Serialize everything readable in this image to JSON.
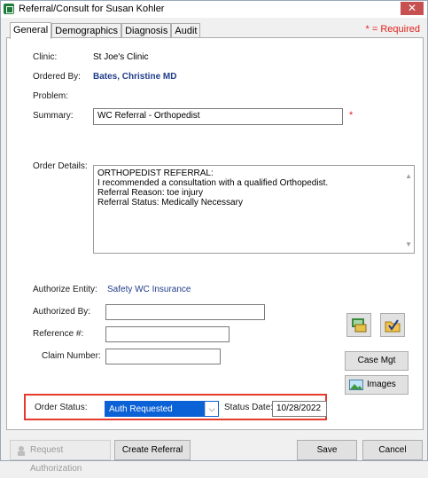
{
  "window": {
    "title": "Referral/Consult for Susan Kohler",
    "close_glyph": "✕"
  },
  "tabs": [
    {
      "label": "General",
      "active": true
    },
    {
      "label": "Demographics",
      "active": false
    },
    {
      "label": "Diagnosis",
      "active": false
    },
    {
      "label": "Audit",
      "active": false
    }
  ],
  "required_note": "* = Required",
  "form": {
    "clinic_label": "Clinic:",
    "clinic_value": "St Joe's Clinic",
    "ordered_by_label": "Ordered By:",
    "ordered_by_value": "Bates, Christine  MD",
    "problem_label": "Problem:",
    "summary_label": "Summary:",
    "summary_value": "WC Referral - Orthopedist",
    "order_details_label": "Order Details:",
    "order_details_lines": [
      "ORTHOPEDIST REFERRAL:",
      "I recommended a consultation with a qualified Orthopedist.",
      "Referral Reason: toe injury",
      "Referral Status: Medically Necessary"
    ],
    "authorize_entity_label": "Authorize Entity:",
    "authorize_entity_value": "Safety WC Insurance",
    "authorized_by_label": "Authorized By:",
    "authorized_by_value": "",
    "reference_label": "Reference #:",
    "reference_value": "",
    "claim_number_label": "Claim Number:",
    "claim_number_value": "",
    "order_status_label": "Order Status:",
    "order_status_value": "Auth Requested",
    "status_date_label": "Status Date:",
    "status_date_value": "10/28/2022"
  },
  "buttons": {
    "case_mgt": "Case Mgt",
    "images": "Images",
    "request_authorization": "Request Authorization",
    "create_referral": "Create Referral",
    "save": "Save",
    "cancel": "Cancel"
  },
  "colors": {
    "required": "#e0211c",
    "link": "#1f3d8a",
    "highlight_box": "#e53b2c",
    "select_bg": "#0b62d6"
  }
}
